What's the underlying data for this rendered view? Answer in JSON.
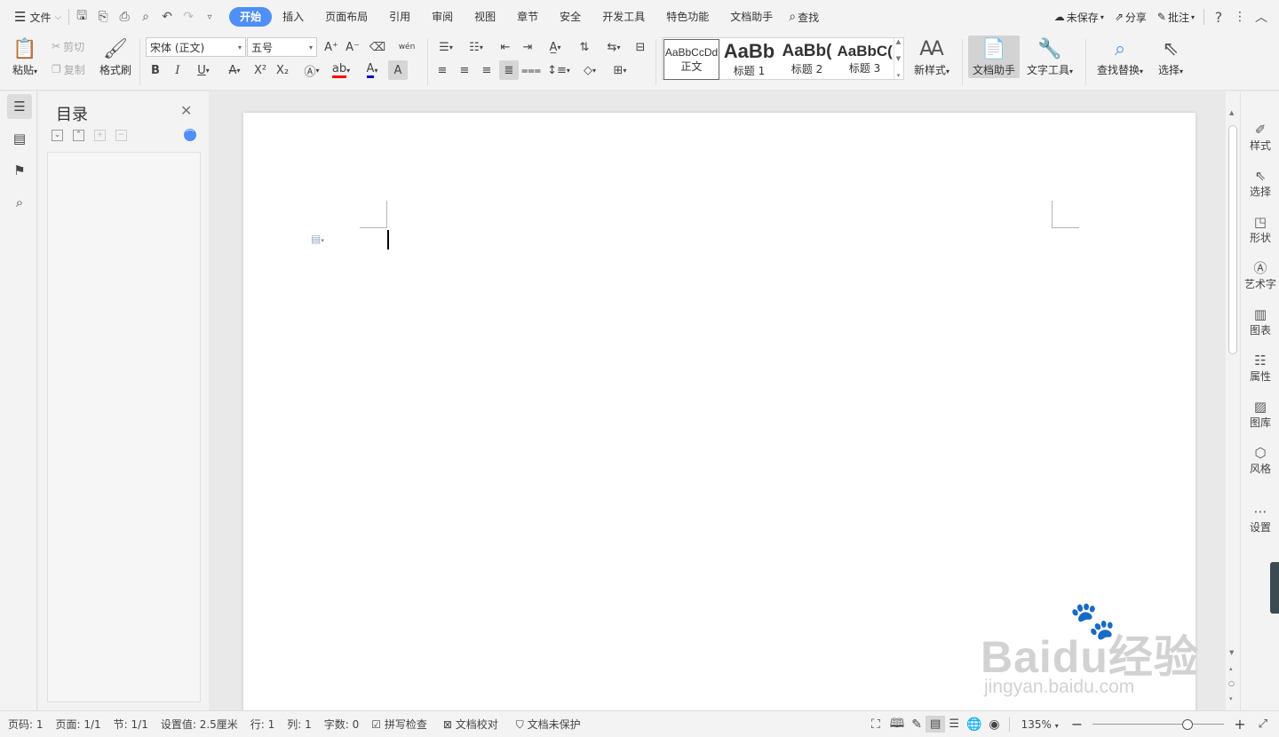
{
  "titlebar": {
    "file_menu": "文件",
    "tabs": [
      "开始",
      "插入",
      "页面布局",
      "引用",
      "审阅",
      "视图",
      "章节",
      "安全",
      "开发工具",
      "特色功能",
      "文档助手"
    ],
    "active_tab": "开始",
    "search": "查找",
    "unsaved": "未保存",
    "share": "分享",
    "comment": "批注",
    "help": "?"
  },
  "ribbon": {
    "paste": "粘贴",
    "cut": "剪切",
    "copy": "复制",
    "format_painter": "格式刷",
    "font_name": "宋体 (正文)",
    "font_size": "五号",
    "phonetic": "wén",
    "styles": [
      {
        "preview": "AaBbCcDd",
        "name": "正文"
      },
      {
        "preview": "AaBb",
        "name": "标题 1"
      },
      {
        "preview": "AaBb(",
        "name": "标题 2"
      },
      {
        "preview": "AaBbC(",
        "name": "标题 3"
      }
    ],
    "new_style": "新样式",
    "doc_assistant": "文档助手",
    "text_tools": "文字工具",
    "find_replace": "查找替换",
    "select": "选择"
  },
  "toc": {
    "title": "目录"
  },
  "right_panel": [
    "样式",
    "选择",
    "形状",
    "艺术字",
    "图表",
    "属性",
    "图库",
    "风格",
    "设置"
  ],
  "statusbar": {
    "page_num": "页码: 1",
    "pages": "页面: 1/1",
    "section": "节: 1/1",
    "setting": "设置值: 2.5厘米",
    "row": "行: 1",
    "col": "列: 1",
    "word_count": "字数: 0",
    "spell_check": "拼写检查",
    "proofread": "文档校对",
    "protection": "文档未保护",
    "zoom": "135%",
    "zoom_fraction": 0.72
  },
  "watermark": {
    "brand": "Baidu经验",
    "url": "jingyan.baidu.com"
  },
  "colors": {
    "accent": "#4f8ff7",
    "highlight": "#ff0000",
    "font_color": "#0000cc"
  }
}
